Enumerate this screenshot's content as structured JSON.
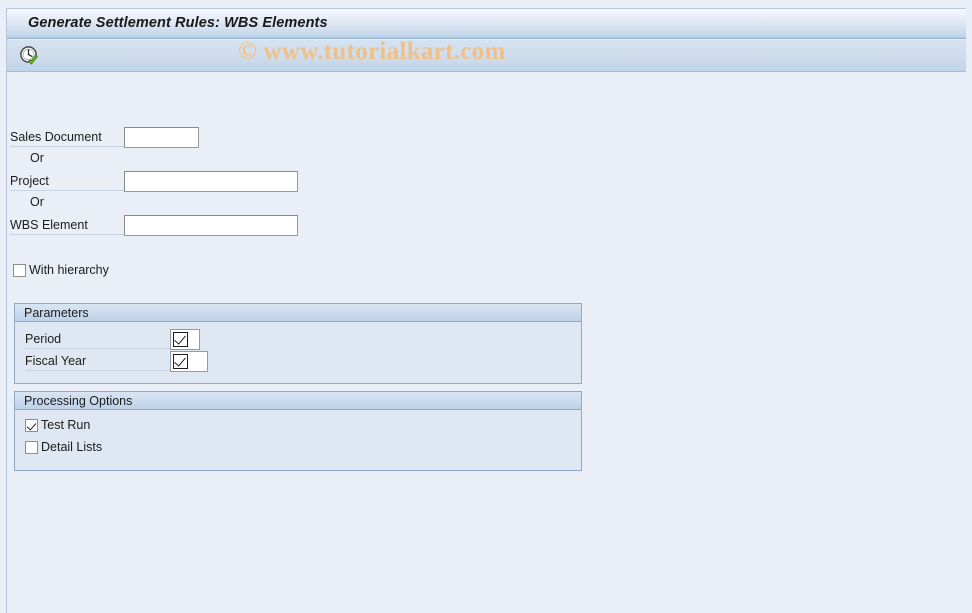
{
  "window": {
    "title": "Generate Settlement Rules: WBS Elements"
  },
  "toolbar": {
    "execute_icon": "clock-check-execute-icon",
    "execute_tooltip": "Execute"
  },
  "watermark": {
    "text": "© www.tutorialkart.com",
    "color": "#f0c089"
  },
  "selection": {
    "fields": [
      {
        "label": "Sales Document",
        "value": "",
        "placeholder": ""
      },
      {
        "label": "Project",
        "value": "",
        "placeholder": ""
      },
      {
        "label": "WBS Element",
        "value": "",
        "placeholder": ""
      }
    ],
    "separators": [
      {
        "text": "Or"
      },
      {
        "text": "Or"
      }
    ],
    "with_hierarchy": {
      "label": "With hierarchy",
      "checked": false
    }
  },
  "parameters": {
    "title": "Parameters",
    "rows": [
      {
        "label": "Period",
        "value": "",
        "marker": "checkbox-check-icon"
      },
      {
        "label": "Fiscal Year",
        "value": "",
        "marker": "checkbox-check-icon"
      }
    ]
  },
  "processing_options": {
    "title": "Processing Options",
    "options": [
      {
        "label": "Test Run",
        "checked": true
      },
      {
        "label": "Detail Lists",
        "checked": false
      }
    ]
  },
  "colors": {
    "background": "#eaeff7",
    "titlebar_gradient_top": "#f6f9fc",
    "titlebar_gradient_bottom": "#b5cbe3",
    "toolbar": "#cedcec",
    "group_border": "#8fa9c6",
    "group_body": "#dfe8f2",
    "text": "#1c1c1c"
  }
}
